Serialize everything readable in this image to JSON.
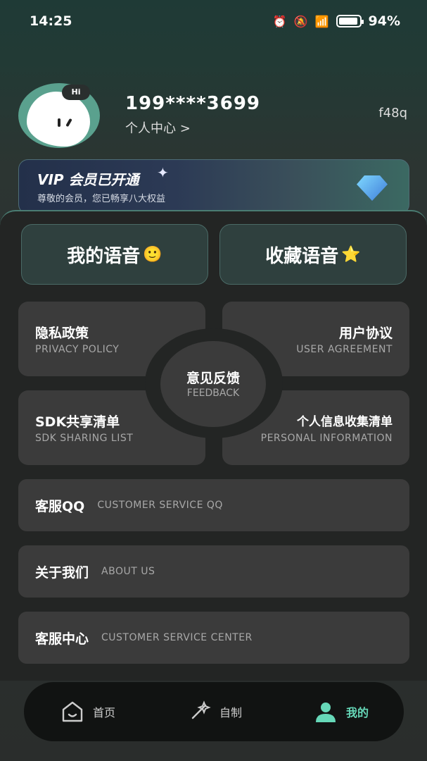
{
  "status_bar": {
    "time": "14:25",
    "battery": "94%",
    "battery_level": 0.94
  },
  "profile": {
    "avatar_badge": "Hi",
    "name": "199****3699",
    "link": "个人中心 >",
    "code": "f48q"
  },
  "vip": {
    "title": "VIP 会员已开通",
    "subtitle": "尊敬的会员，您已畅享八大权益"
  },
  "quick_actions": [
    {
      "label": "我的语音"
    },
    {
      "label": "收藏语音"
    }
  ],
  "cards": [
    {
      "title": "隐私政策",
      "sub": "PRIVACY POLICY"
    },
    {
      "title": "用户协议",
      "sub": "USER AGREEMENT"
    },
    {
      "title": "SDK共享清单",
      "sub": "SDK SHARING LIST"
    },
    {
      "title": "个人信息收集清单",
      "sub": "PERSONAL INFORMATION"
    }
  ],
  "feedback": {
    "title": "意见反馈",
    "sub": "FEEDBACK"
  },
  "rows": [
    {
      "title": "客服QQ",
      "sub": "CUSTOMER SERVICE QQ"
    },
    {
      "title": "关于我们",
      "sub": "ABOUT US"
    },
    {
      "title": "客服中心",
      "sub": "CUSTOMER SERVICE CENTER"
    }
  ],
  "tabs": [
    {
      "label": "首页",
      "icon": "home-icon"
    },
    {
      "label": "自制",
      "icon": "sparkle-icon"
    },
    {
      "label": "我的",
      "icon": "user-icon",
      "active": true
    }
  ],
  "colors": {
    "accent": "#66d8b8",
    "card": "#3b3b3b",
    "panel": "#232524"
  }
}
